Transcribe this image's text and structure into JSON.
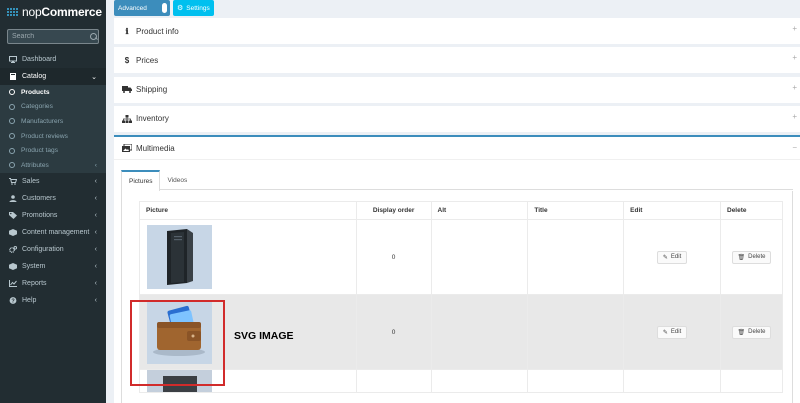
{
  "sidebar": {
    "brand": "nopCommerce",
    "search_placeholder": "Search",
    "items": [
      {
        "label": "Dashboard",
        "icon": "monitor-icon"
      },
      {
        "label": "Catalog",
        "icon": "book-icon",
        "open": true
      },
      {
        "label": "Sales",
        "icon": "cart-icon"
      },
      {
        "label": "Customers",
        "icon": "user-icon"
      },
      {
        "label": "Promotions",
        "icon": "tag-icon"
      },
      {
        "label": "Content management",
        "icon": "cube-icon"
      },
      {
        "label": "Configuration",
        "icon": "gears-icon"
      },
      {
        "label": "System",
        "icon": "cube-icon"
      },
      {
        "label": "Reports",
        "icon": "line-chart-icon"
      },
      {
        "label": "Help",
        "icon": "question-icon"
      }
    ],
    "catalog_sub": [
      {
        "label": "Products",
        "active": true
      },
      {
        "label": "Categories"
      },
      {
        "label": "Manufacturers"
      },
      {
        "label": "Product reviews"
      },
      {
        "label": "Product tags"
      },
      {
        "label": "Attributes"
      }
    ]
  },
  "topbar": {
    "advanced_label": "Advanced",
    "settings_label": "Settings"
  },
  "panels": [
    {
      "label": "Product info",
      "icon": "info-icon",
      "toggle": "+"
    },
    {
      "label": "Prices",
      "icon": "dollar-icon",
      "toggle": "+"
    },
    {
      "label": "Shipping",
      "icon": "truck-icon",
      "toggle": "+"
    },
    {
      "label": "Inventory",
      "icon": "sitemap-icon",
      "toggle": "+"
    },
    {
      "label": "Multimedia",
      "icon": "images-icon",
      "toggle": "−"
    }
  ],
  "multimedia": {
    "tabs": [
      "Pictures",
      "Videos"
    ],
    "columns": [
      "Picture",
      "Display order",
      "Alt",
      "Title",
      "Edit",
      "Delete"
    ],
    "rows": [
      {
        "display_order": "0",
        "alt": "",
        "title": "",
        "edit": "Edit",
        "delete": "Delete",
        "image": "pc-tower"
      },
      {
        "display_order": "0",
        "alt": "",
        "title": "",
        "edit": "Edit",
        "delete": "Delete",
        "image": "wallet"
      }
    ],
    "annotation_label": "SVG IMAGE"
  },
  "colors": {
    "sidebar_bg": "#222d32",
    "accent": "#3c8dbc",
    "info": "#00c0ef",
    "highlight": "#d12b2b"
  }
}
